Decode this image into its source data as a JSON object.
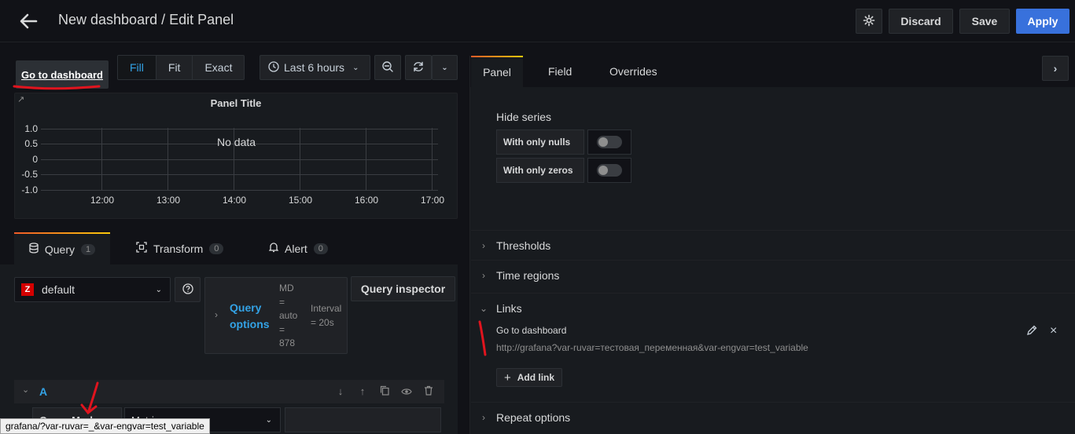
{
  "header": {
    "title": "New dashboard / Edit Panel",
    "discard_label": "Discard",
    "save_label": "Save",
    "apply_label": "Apply"
  },
  "toolbar": {
    "go_to_dashboard": "Go to dashboard",
    "fit_options": [
      "Fill",
      "Fit",
      "Exact"
    ],
    "active_fit": "Fill",
    "time_range": "Last 6 hours"
  },
  "panel": {
    "title": "Panel Title",
    "no_data": "No data",
    "y_ticks": [
      "1.0",
      "0.5",
      "0",
      "-0.5",
      "-1.0"
    ],
    "x_ticks": [
      "12:00",
      "13:00",
      "14:00",
      "15:00",
      "16:00",
      "17:00"
    ]
  },
  "query_tabs": [
    {
      "label": "Query",
      "count": "1"
    },
    {
      "label": "Transform",
      "count": "0"
    },
    {
      "label": "Alert",
      "count": "0"
    }
  ],
  "query": {
    "datasource": "default",
    "options_label": "Query options",
    "md_text": [
      "MD",
      "=",
      "auto",
      "=",
      "878"
    ],
    "interval_text": [
      "Interval",
      "= 20s"
    ],
    "inspector_label": "Query inspector",
    "row_letter": "A",
    "query_mode": "Query Mode",
    "metrics": "Metrics"
  },
  "options_tabs": [
    "Panel",
    "Field",
    "Overrides"
  ],
  "hide_series": {
    "title": "Hide series",
    "options": [
      "With only nulls",
      "With only zeros"
    ]
  },
  "sections": {
    "thresholds": "Thresholds",
    "time_regions": "Time regions",
    "links": "Links",
    "repeat": "Repeat options"
  },
  "link": {
    "title": "Go to dashboard",
    "url": "http://grafana?var-ruvar=тестовая_переменная&var-engvar=test_variable",
    "add_label": "Add link"
  },
  "status_tooltip": "grafana/?var-ruvar=_&var-engvar=test_variable",
  "colors": {
    "accent": "#3871dc",
    "active_text": "#33a2e5",
    "annotation": "#e0141e"
  }
}
